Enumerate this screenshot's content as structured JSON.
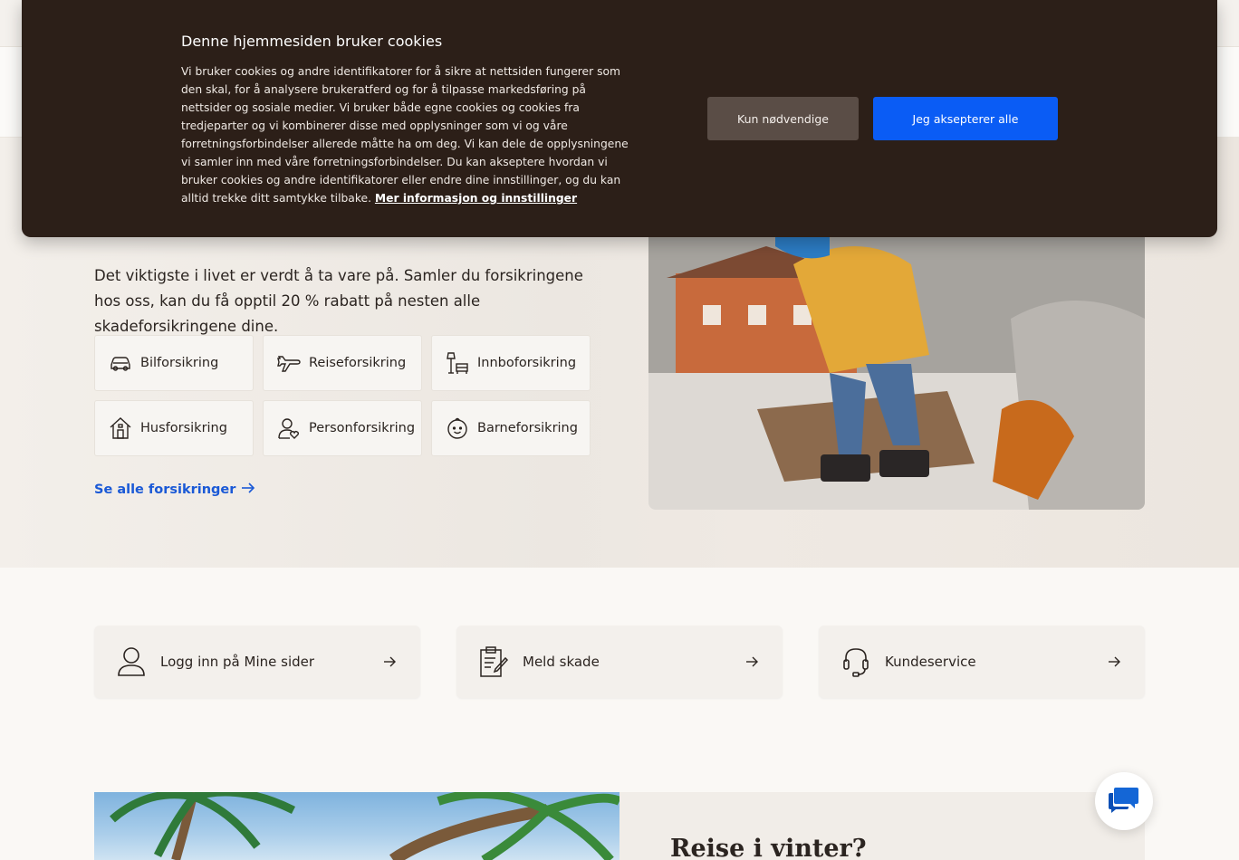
{
  "cookie_banner": {
    "title": "Denne hjemmesiden bruker cookies",
    "body": "Vi bruker cookies og andre identifikatorer for å sikre at nettsiden fungerer som den skal, for å analysere brukeratferd og for å tilpasse markedsføring på nettsider og sosiale medier. Vi bruker både egne cookies og cookies fra tredjeparter og vi kombinerer disse med opplysninger som vi og våre forretningsforbindelser allerede måtte ha om deg. Vi kan dele de opplysningene vi samler inn med våre forretningsforbindelser. Du kan akseptere hvordan vi bruker cookies og andre identifikatorer eller endre dine innstillinger, og du kan alltid trekke ditt samtykke tilbake.",
    "more_link": "Mer informasjon og innstillinger",
    "necessary_button": "Kun nødvendige",
    "accept_button": "Jeg aksepterer alle",
    "accent_color": "#0a5cf5"
  },
  "hero": {
    "text": "Det viktigste i livet er verdt å ta vare på. Samler du forsikringene hos oss, kan du få opptil 20 % rabatt på nesten alle skadeforsikringene dine.",
    "insurances": [
      {
        "label": "Bilforsikring",
        "icon": "car-icon"
      },
      {
        "label": "Reiseforsikring",
        "icon": "airplane-icon"
      },
      {
        "label": "Innboforsikring",
        "icon": "lamp-sofa-icon"
      },
      {
        "label": "Husforsikring",
        "icon": "house-icon"
      },
      {
        "label": "Personforsikring",
        "icon": "person-heart-icon"
      },
      {
        "label": "Barneforsikring",
        "icon": "baby-face-icon"
      }
    ],
    "see_all": "Se alle forsikringer"
  },
  "quick_links": [
    {
      "label": "Logg inn på Mine sider",
      "icon": "user-icon"
    },
    {
      "label": "Meld skade",
      "icon": "clipboard-icon"
    },
    {
      "label": "Kundeservice",
      "icon": "headset-icon"
    }
  ],
  "promo": {
    "title": "Reise i vinter?"
  }
}
